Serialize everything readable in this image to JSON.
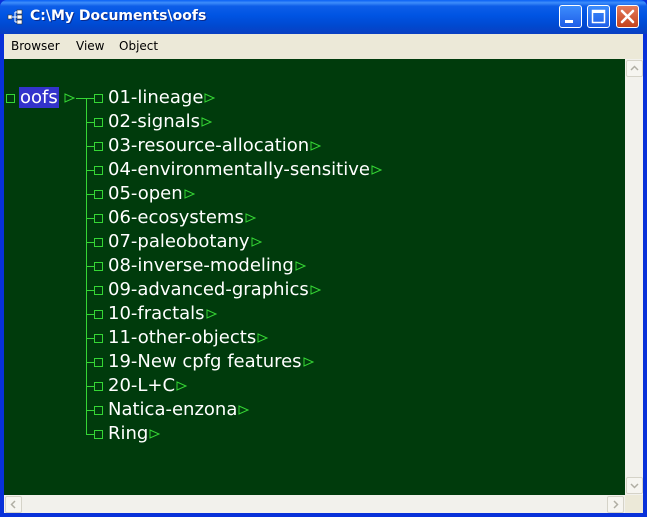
{
  "window": {
    "title": "C:\\My Documents\\oofs"
  },
  "menu": [
    "Browser",
    "View",
    "Object"
  ],
  "tree": {
    "root": "oofs",
    "children": [
      "01-lineage",
      "02-signals",
      "03-resource-allocation",
      "04-environmentally-sensitive",
      "05-open",
      "06-ecosystems",
      "07-paleobotany",
      "08-inverse-modeling",
      "09-advanced-graphics",
      "10-fractals",
      "11-other-objects",
      "19-New cpfg features",
      "20-L+C",
      "Natica-enzona",
      "Ring"
    ]
  },
  "colors": {
    "canvas": "#003b0c",
    "connector": "#35d635",
    "selection": "#3333cc",
    "label": "#ffffff"
  },
  "icons": [
    "tree-view-icon",
    "minimize-icon",
    "maximize-icon",
    "close-icon",
    "scroll-up-icon",
    "scroll-down-icon",
    "scroll-left-icon",
    "scroll-right-icon",
    "expand-arrow-icon",
    "node-box-icon"
  ]
}
